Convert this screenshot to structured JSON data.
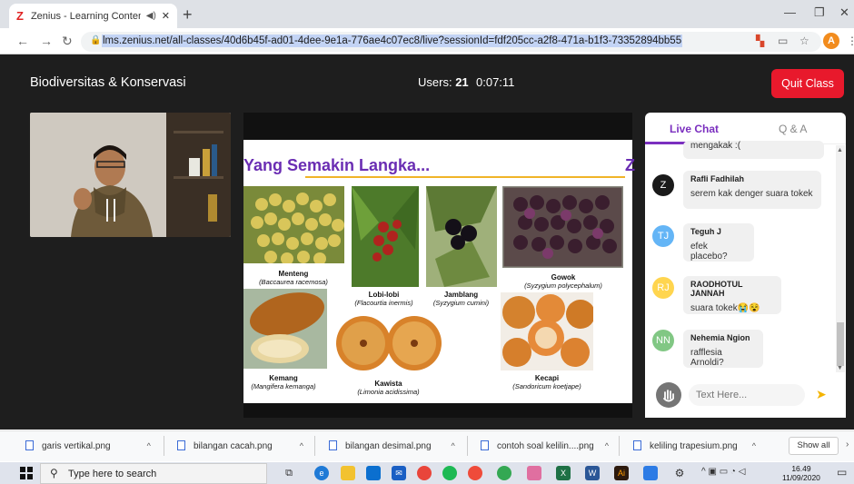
{
  "browser": {
    "tab_title": "Zenius - Learning Content M",
    "tab_logo": "Z",
    "url": "lms.zenius.net/all-classes/40d6b45f-ad01-4dee-9e1a-776ae4c07ec8/live?sessionId=fdf205cc-a2f8-471a-b1f3-73352894bb55",
    "profile_initial": "A"
  },
  "header": {
    "course_title": "Biodiversitas & Konservasi",
    "users_label": "Users:",
    "users_count": "21",
    "timer": "0:07:11",
    "quit_label": "Quit Class"
  },
  "slide": {
    "title": "Yang Semakin Langka...",
    "items": [
      {
        "name": "Menteng",
        "latin": "Baccaurea racemosa"
      },
      {
        "name": "Lobi-lobi",
        "latin": "Flacourtia inermis"
      },
      {
        "name": "Jamblang",
        "latin": "Syzygium cumini"
      },
      {
        "name": "Gowok",
        "latin": "Syzygium polycephalum"
      },
      {
        "name": "Kemang",
        "latin": "Mangifera kemanga"
      },
      {
        "name": "Kawista",
        "latin": "Limonia acidissima"
      },
      {
        "name": "Kecapi",
        "latin": "Sandoricum koetjape"
      }
    ]
  },
  "chat": {
    "tabs": [
      "Live Chat",
      "Q & A"
    ],
    "partial_message": "mengakak :(",
    "messages": [
      {
        "initials": "Z",
        "name": "Rafli Fadhilah",
        "text": "serem kak denger suara tokek",
        "color": "#1a1a1a"
      },
      {
        "initials": "TJ",
        "name": "Teguh J",
        "text": "efek placebo?",
        "color": "#64b5f6"
      },
      {
        "initials": "RJ",
        "name": "RAODHOTUL JANNAH",
        "text": "suara tokek😭😵",
        "color": "#ffd54f"
      },
      {
        "initials": "NN",
        "name": "Nehemia Ngion",
        "text": "rafflesia Arnoldi?",
        "color": "#81c784"
      }
    ],
    "input_placeholder": "Text Here..."
  },
  "downloads": {
    "items": [
      "garis vertikal.png",
      "bilangan cacah.png",
      "bilangan desimal.png",
      "contoh soal kelilin....png",
      "keliling trapesium.png"
    ],
    "show_all": "Show all"
  },
  "taskbar": {
    "search_placeholder": "Type here to search",
    "time": "16.49",
    "date": "11/09/2020"
  },
  "colors": {
    "accent": "#7b2fbf",
    "quit": "#e8192c",
    "app_bg": "#1e1e1e"
  }
}
